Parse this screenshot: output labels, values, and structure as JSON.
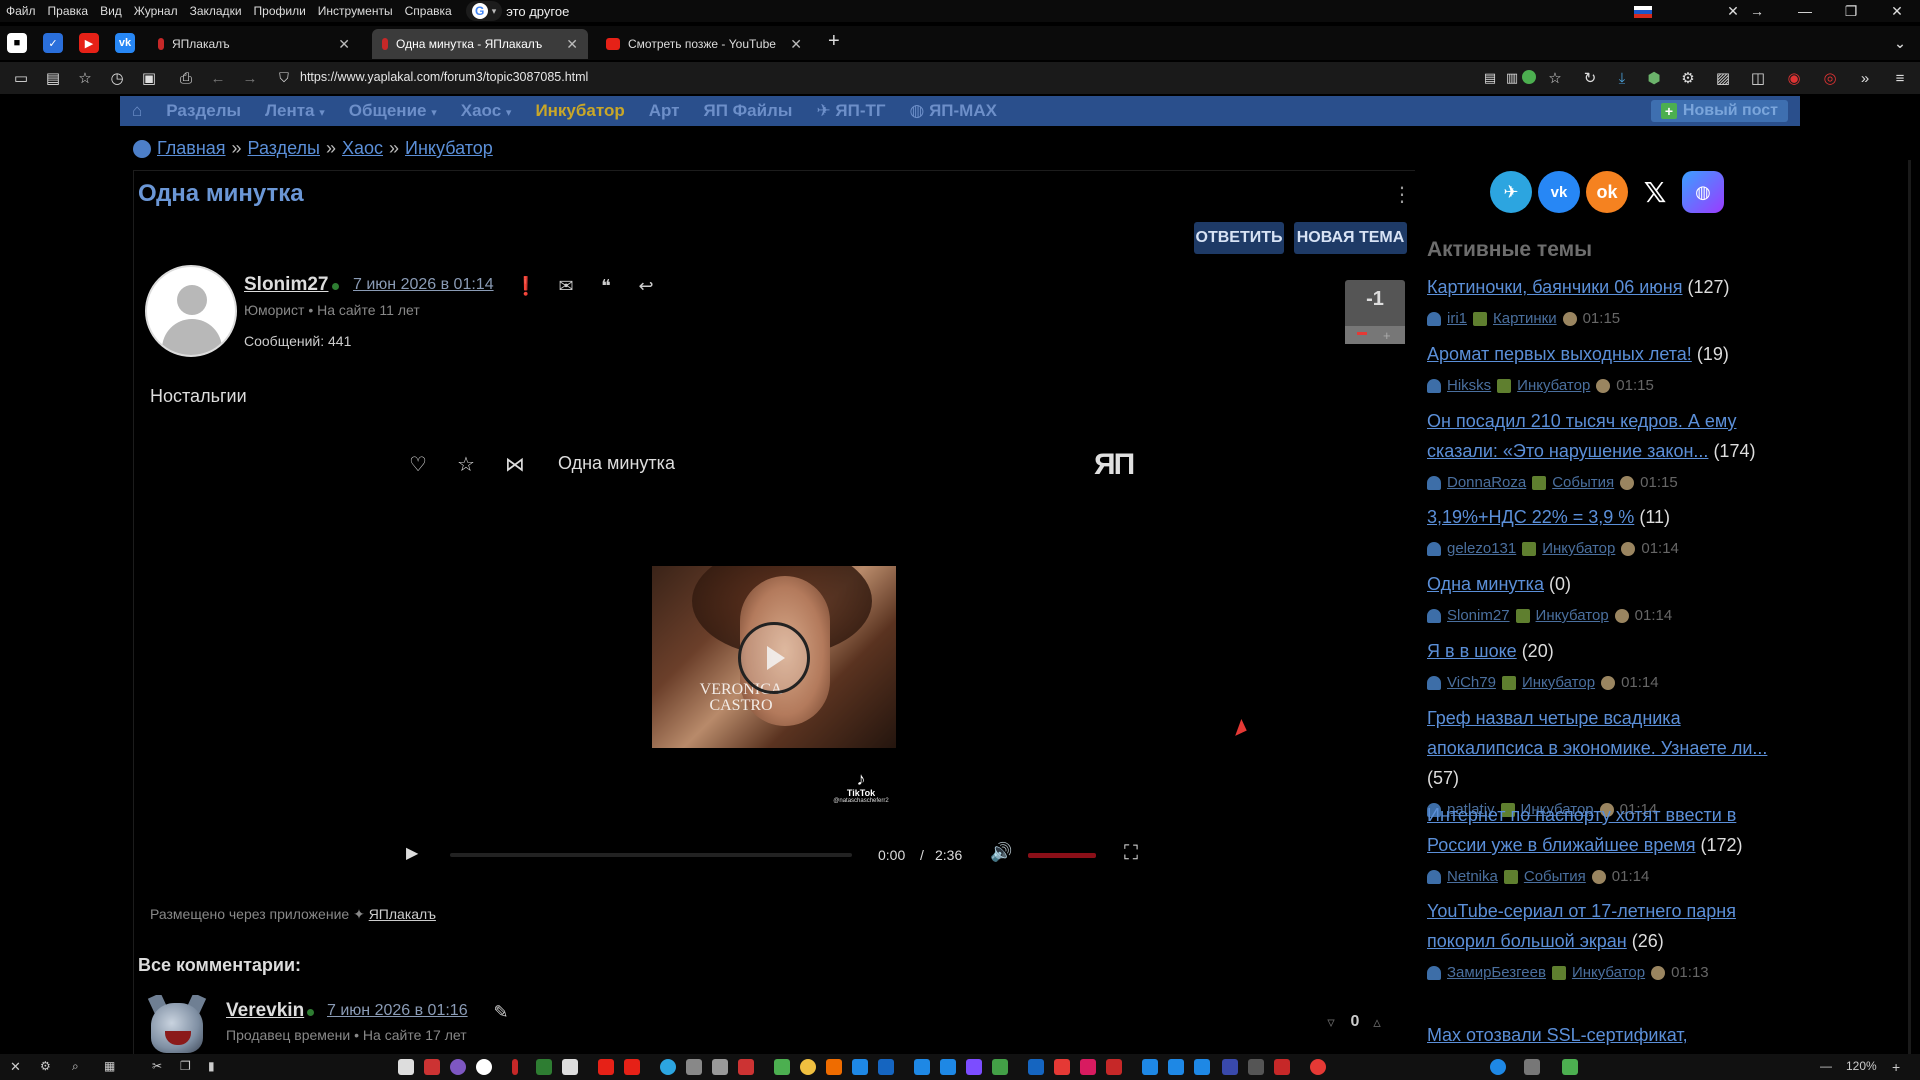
{
  "os_menu": {
    "items": [
      "Файл",
      "Правка",
      "Вид",
      "Журнал",
      "Закладки",
      "Профили",
      "Инструменты",
      "Справка"
    ],
    "google_text": "это другое"
  },
  "tabs": [
    {
      "label": "ЯПлакалъ",
      "active": false
    },
    {
      "label": "Одна минутка - ЯПлакалъ",
      "active": true
    },
    {
      "label": "Смотреть позже - YouTube",
      "active": false
    }
  ],
  "address": {
    "url": "https://www.yaplakal.com/forum3/topic3087085.html"
  },
  "site_nav": {
    "items": [
      "Разделы",
      "Лента",
      "Общение",
      "Хаос",
      "Инкубатор",
      "Арт",
      "ЯП Файлы",
      "ЯП-ТГ",
      "ЯП-МАХ"
    ],
    "new_post": "Новый пост"
  },
  "breadcrumb": {
    "items": [
      "Главная",
      "Разделы",
      "Хаос",
      "Инкубатор"
    ],
    "sep": "»"
  },
  "topic": {
    "title": "Одна минутка",
    "reply_btn": "ОТВЕТИТЬ",
    "new_topic_btn": "НОВАЯ ТЕМА"
  },
  "post": {
    "author": "Slonim27",
    "date": "7 июн 2026 в 01:14",
    "rank": "Юморист",
    "on_site": "На сайте 11 лет",
    "messages": "Сообщений: 441",
    "rating": "-1",
    "text": "Ностальгии",
    "embed_title": "Одна минутка",
    "yp_logo": "ЯП",
    "video_caption_1": "VERONICA",
    "video_caption_2": "CASTRO",
    "tiktok_label": "TikTok",
    "tiktok_handle": "@nataschascheferr2",
    "time_current": "0:00",
    "time_sep": "/",
    "time_total": "2:36",
    "progress": 0.0,
    "volume": 1.0,
    "posted_via": "Размещено через приложение",
    "posted_app": "ЯПлакалъ"
  },
  "comments": {
    "header": "Все комментарии:",
    "first": {
      "author": "Verevkin",
      "date": "7 июн 2026 в 01:16",
      "rank": "Продавец времени",
      "on_site": "На сайте 17 лет",
      "rating": "0"
    }
  },
  "sidebar": {
    "heading": "Активные темы",
    "topics": [
      {
        "title": "Картиночки, баянчики 06 июня",
        "count": "(127)",
        "user": "iri1",
        "section": "Картинки",
        "time": "01:15"
      },
      {
        "title": "Аромат первых выходных лета!",
        "count": "(19)",
        "user": "Hiksks",
        "section": "Инкубатор",
        "time": "01:15"
      },
      {
        "title": "Он посадил 210 тысяч кедров. А ему сказали: «Это нарушение закон...",
        "count": "(174)",
        "user": "DonnaRoza",
        "section": "События",
        "time": "01:15"
      },
      {
        "title": "3,19%+НДС 22% = 3,9 %",
        "count": "(11)",
        "user": "gelezo131",
        "section": "Инкубатор",
        "time": "01:14"
      },
      {
        "title": "Одна минутка",
        "count": "(0)",
        "user": "Slonim27",
        "section": "Инкубатор",
        "time": "01:14"
      },
      {
        "title": "Я в в шоке",
        "count": "(20)",
        "user": "ViCh79",
        "section": "Инкубатор",
        "time": "01:14"
      },
      {
        "title": "Греф назвал четыре всадника апокалипсиса в экономике. Узнаете ли...",
        "count": "(57)",
        "user": "patlatiy",
        "section": "Инкубатор",
        "time": "01:14"
      },
      {
        "title": "Интернет по паспорту хотят ввести в России уже в ближайшее время",
        "count": "(172)",
        "user": "Netnika",
        "section": "События",
        "time": "01:14"
      },
      {
        "title": "YouTube-сериал от 17-летнего парня покорил большой экран",
        "count": "(26)",
        "user": "ЗамирБезгеев",
        "section": "Инкубатор",
        "time": "01:13"
      },
      {
        "title": "Max отозвали SSL-сертификат,",
        "count": "",
        "user": "",
        "section": "",
        "time": ""
      }
    ]
  },
  "taskbar": {
    "zoom": "120%"
  },
  "colors": {
    "link": "#5b8fd8",
    "nav_bg": "#2a4f8c",
    "incubator": "#c9a728",
    "volume": "#8b0f18"
  }
}
